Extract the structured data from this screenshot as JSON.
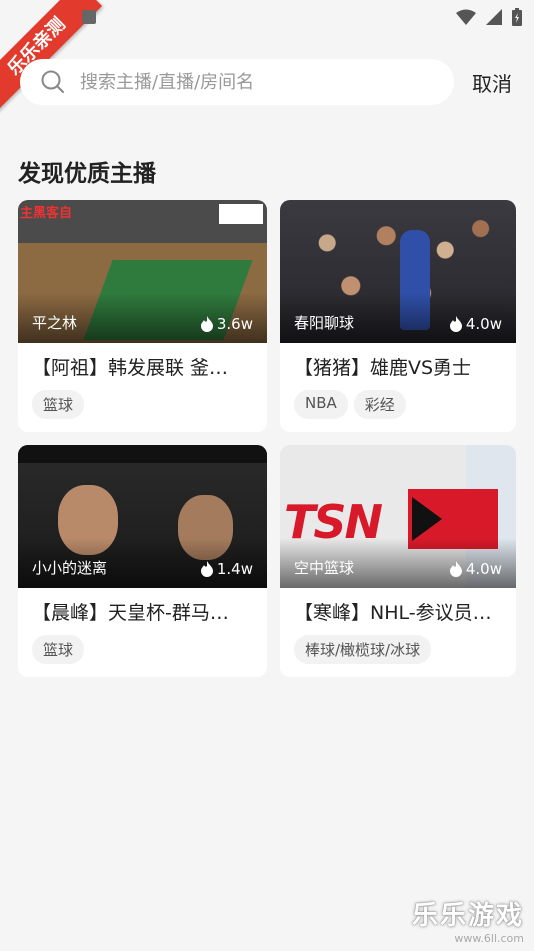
{
  "status_bar": {
    "banner_text": "乐乐亲测"
  },
  "search": {
    "placeholder": "搜索主播/直播/房间名",
    "value": "",
    "cancel_label": "取消"
  },
  "section": {
    "title": "发现优质主播"
  },
  "cards": [
    {
      "streamer": "平之林",
      "views": "3.6w",
      "title": "【阿祖】韩发展联 釜…",
      "tags": [
        "篮球"
      ]
    },
    {
      "streamer": "春阳聊球",
      "views": "4.0w",
      "title": "【猪猪】雄鹿VS勇士",
      "tags": [
        "NBA",
        "彩经"
      ]
    },
    {
      "streamer": "小小的迷离",
      "views": "1.4w",
      "title": "【晨峰】天皇杯-群马…",
      "tags": [
        "篮球"
      ]
    },
    {
      "streamer": "空中篮球",
      "views": "4.0w",
      "title": "【寒峰】NHL-参议员…",
      "tags": [
        "棒球/橄榄球/冰球"
      ]
    }
  ],
  "thumbnail_text": {
    "card1_overlay": "主黑客自",
    "card4_logo": "TSN"
  },
  "watermark": {
    "main": "乐乐游戏",
    "sub": "www.6ll.com"
  },
  "colors": {
    "background": "#f5f5f5",
    "banner": "#e23b2e",
    "card": "#ffffff",
    "tag_bg": "#f2f2f2"
  }
}
